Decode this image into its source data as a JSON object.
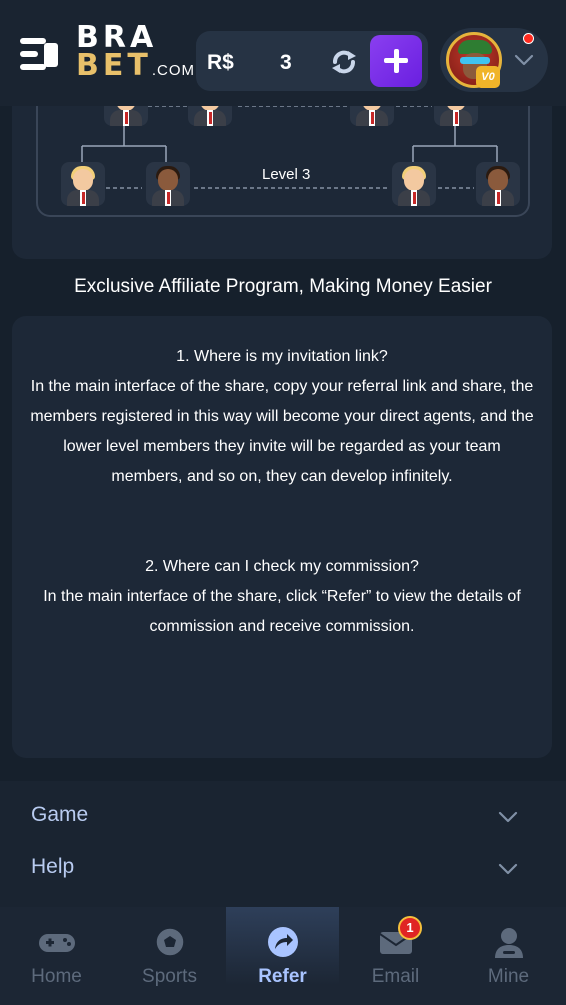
{
  "header": {
    "logo_top": "BRA",
    "logo_bottom": "BET",
    "logo_suffix": ".COM",
    "currency": "R$",
    "balance": "3",
    "vip_label": "V0"
  },
  "tree": {
    "level_label": "Level 3"
  },
  "promo": {
    "title": "Exclusive Affiliate Program, Making Money Easier"
  },
  "faq": [
    {
      "question": "1. Where is my invitation link?",
      "answer": "In the main interface of the share, copy your referral link and share, the members registered in this way will become your direct agents, and the lower level members they invite will be regarded as your team members, and so on, they can develop infinitely."
    },
    {
      "question": "2. Where can I check my commission?",
      "answer": "In the main interface of the share, click “Refer” to view the details of commission and receive commission."
    }
  ],
  "footer": {
    "sections": [
      {
        "label": "Game"
      },
      {
        "label": "Help"
      }
    ]
  },
  "nav": {
    "items": [
      {
        "label": "Home",
        "icon": "gamepad-icon"
      },
      {
        "label": "Sports",
        "icon": "soccer-ball-icon"
      },
      {
        "label": "Refer",
        "icon": "share-arrow-icon",
        "active": true
      },
      {
        "label": "Email",
        "icon": "envelope-icon"
      },
      {
        "label": "Mine",
        "icon": "user-icon"
      }
    ],
    "email_badge": "1"
  },
  "colors": {
    "background": "#16202c",
    "card": "#1d2837",
    "accent": "#a9c4ff",
    "deposit": "#7a2fe8",
    "logo_gold": "#e8c06a"
  }
}
